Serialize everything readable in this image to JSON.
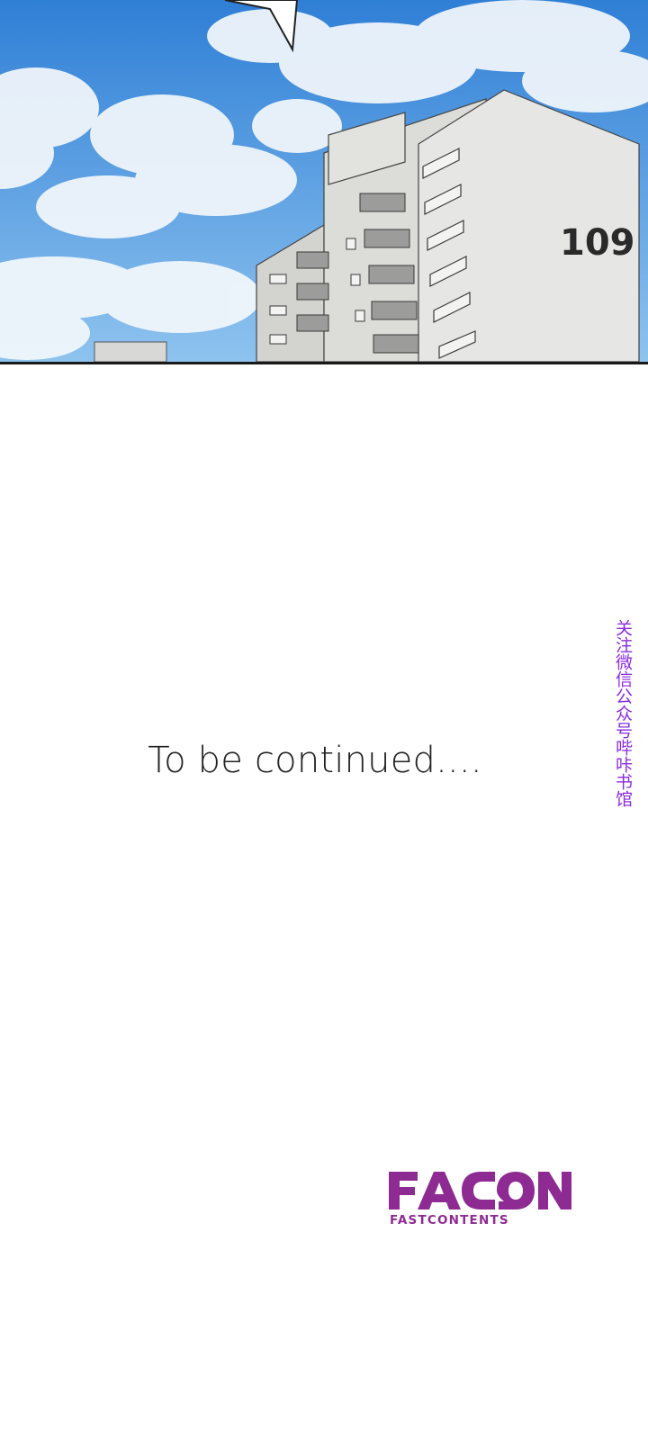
{
  "panel": {
    "building_number": "109",
    "colors": {
      "sky_top": "#2f7fd6",
      "sky_bottom": "#8ec3ef",
      "cloud": "#f4f8fc",
      "building_front": "#e6e6e4",
      "building_side": "#d3d3d0",
      "border": "#1a1a1a"
    }
  },
  "ending": {
    "text": "To be continued...."
  },
  "watermark": {
    "text": "关注微信公众号哔咔书馆",
    "color": "#8a2be2"
  },
  "logo": {
    "name": "FACON",
    "tagline": "FASTCONTENTS",
    "color": "#8e2b93"
  }
}
